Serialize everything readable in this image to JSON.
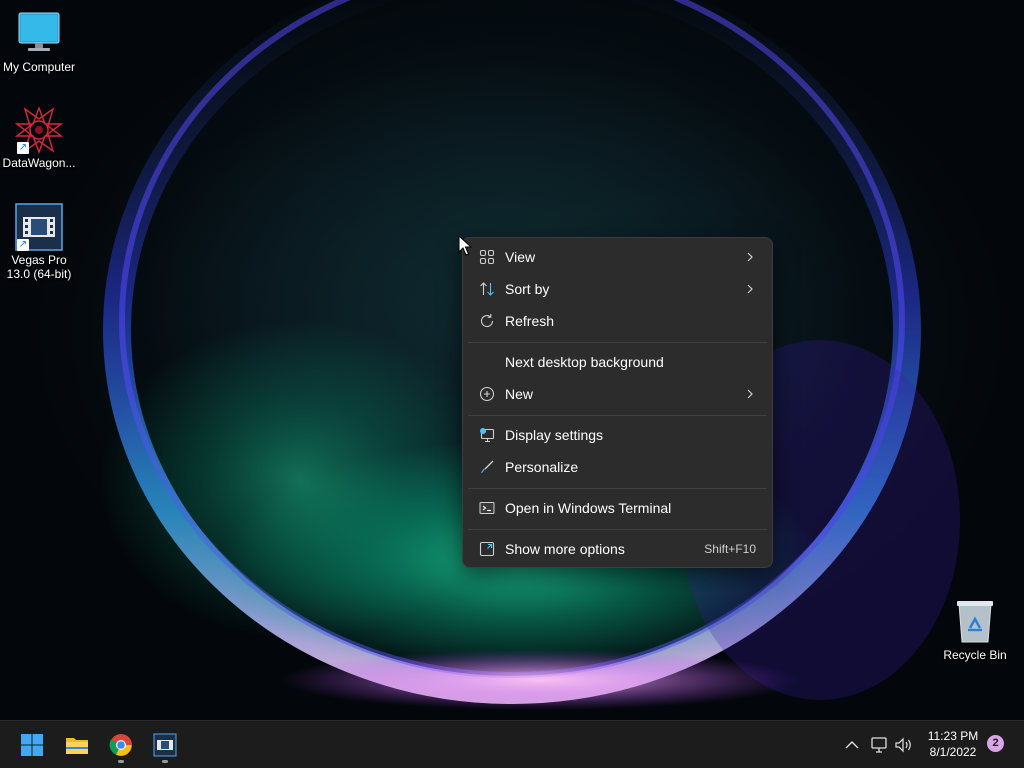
{
  "desktop": {
    "icons": [
      {
        "label": "My Computer",
        "icon": "monitor-icon"
      },
      {
        "label": "DataWagon...",
        "icon": "datawagon-logo-icon"
      },
      {
        "label": "Vegas Pro\n13.0 (64-bit)",
        "label_line1": "Vegas Pro",
        "label_line2": "13.0 (64-bit)",
        "icon": "film-strip-icon"
      },
      {
        "label": "Recycle Bin",
        "icon": "recycle-bin-icon"
      }
    ]
  },
  "context_menu": {
    "items": [
      {
        "label": "View",
        "icon": "grid-view-icon",
        "submenu": true
      },
      {
        "label": "Sort by",
        "icon": "sort-arrows-icon",
        "submenu": true
      },
      {
        "label": "Refresh",
        "icon": "refresh-icon",
        "submenu": false
      },
      {
        "label": "Next desktop background",
        "icon": "",
        "submenu": false
      },
      {
        "label": "New",
        "icon": "plus-circle-icon",
        "submenu": true
      },
      {
        "label": "Display settings",
        "icon": "display-settings-icon",
        "submenu": false
      },
      {
        "label": "Personalize",
        "icon": "brush-icon",
        "submenu": false
      },
      {
        "label": "Open in Windows Terminal",
        "icon": "terminal-icon",
        "submenu": false
      },
      {
        "label": "Show more options",
        "icon": "more-options-icon",
        "shortcut": "Shift+F10",
        "submenu": false
      }
    ]
  },
  "taskbar": {
    "apps": [
      {
        "name": "Start",
        "icon": "windows-start-icon",
        "running": false
      },
      {
        "name": "File Explorer",
        "icon": "folder-icon",
        "running": false
      },
      {
        "name": "Google Chrome",
        "icon": "chrome-icon",
        "running": true
      },
      {
        "name": "Vegas Pro",
        "icon": "film-strip-icon",
        "running": true
      }
    ],
    "tray": {
      "icons": [
        "chevron-up-icon",
        "network-icon",
        "volume-icon"
      ],
      "time": "11:23 PM",
      "date": "8/1/2022",
      "notification_count": "2"
    }
  },
  "colors": {
    "menu_bg": "#2c2c2c",
    "taskbar_bg": "#1c1c1c",
    "accent": "#4cc2ff",
    "badge": "#d8a6e8"
  }
}
